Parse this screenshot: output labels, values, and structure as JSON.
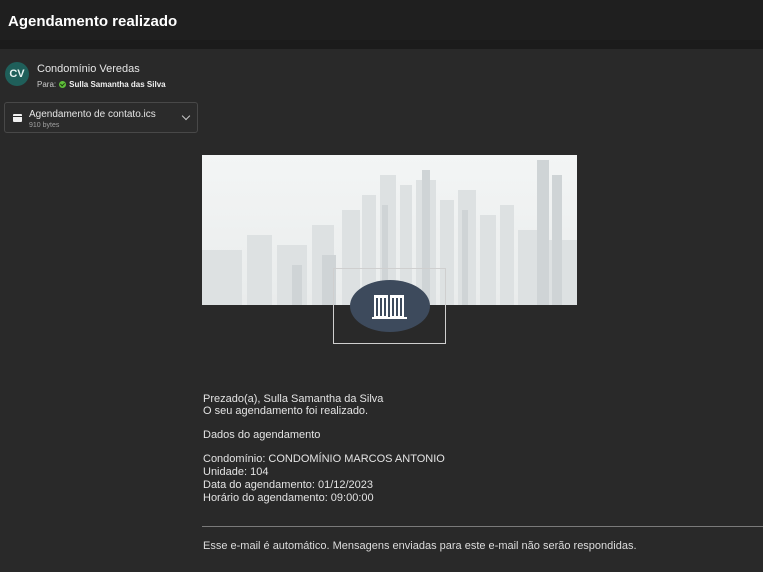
{
  "header": {
    "title": "Agendamento realizado"
  },
  "message": {
    "avatar_initials": "CV",
    "sender": "Condomínio Veredas",
    "to_label": "Para:",
    "recipient": "Sulla Samantha das Silva"
  },
  "attachment": {
    "filename": "Agendamento de contato.ics",
    "size": "910 bytes"
  },
  "email_body": {
    "greeting": "Prezado(a), Sulla Samantha da Silva",
    "confirmation": "O seu agendamento foi realizado.",
    "section_title": "Dados do agendamento",
    "condominio": "Condomínio: CONDOMÍNIO MARCOS ANTONIO",
    "unidade": "Unidade: 104",
    "data": "Data do agendamento: 01/12/2023",
    "horario": "Horário do agendamento: 09:00:00",
    "footer": "Esse e-mail é automático. Mensagens enviadas para este e-mail não serão respondidas."
  },
  "colors": {
    "background": "#292929",
    "header": "#1f1f1f",
    "avatar": "#1f5f5a",
    "presence": "#5fbf3a",
    "badge": "#3d4a5c"
  }
}
